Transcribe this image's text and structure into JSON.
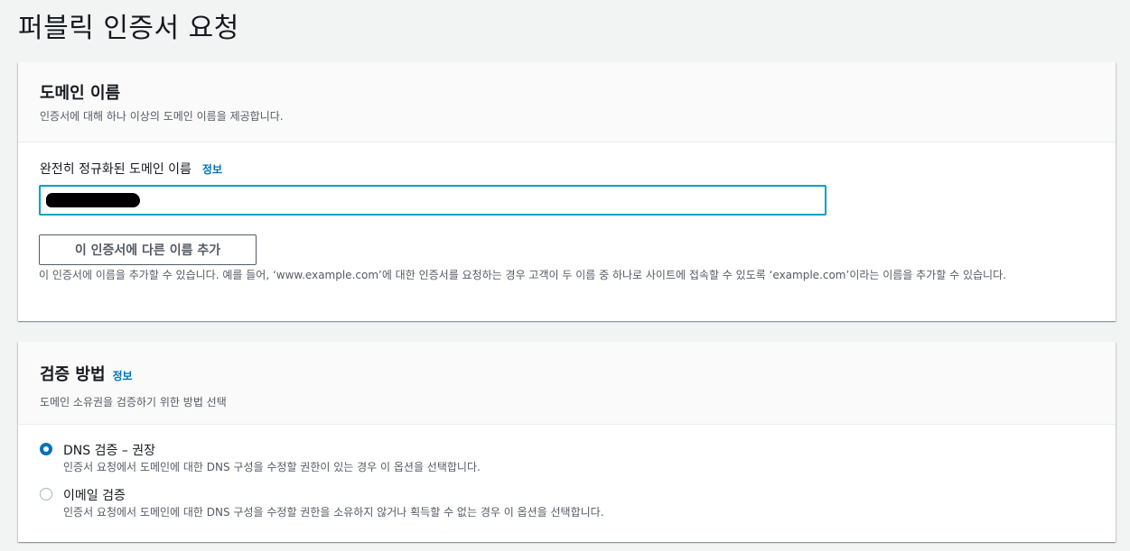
{
  "page": {
    "title": "퍼블릭 인증서 요청"
  },
  "domain_panel": {
    "title": "도메인 이름",
    "description": "인증서에 대해 하나 이상의 도메인 이름을 제공합니다.",
    "field_label": "완전히 정규화된 도메인 이름",
    "info_link": "정보",
    "domain_value": "",
    "add_button": "이 인증서에 다른 이름 추가",
    "help_text": "이 인증서에 이름을 추가할 수 있습니다. 예를 들어, ‘www.example.com’에 대한 인증서를 요청하는 경우 고객이 두 이름 중 하나로 사이트에 접속할 수 있도록 ‘example.com’이라는 이름을 추가할 수 있습니다."
  },
  "validation_panel": {
    "title": "검증 방법",
    "info_link": "정보",
    "description": "도메인 소유권을 검증하기 위한 방법 선택",
    "options": [
      {
        "label": "DNS 검증 – 권장",
        "description": "인증서 요청에서 도메인에 대한 DNS 구성을 수정할 권한이 있는 경우 이 옵션을 선택합니다.",
        "selected": true
      },
      {
        "label": "이메일 검증",
        "description": "인증서 요청에서 도메인에 대한 DNS 구성을 수정할 권한을 소유하지 않거나 획득할 수 없는 경우 이 옵션을 선택합니다.",
        "selected": false
      }
    ]
  },
  "colors": {
    "accent": "#0073bb",
    "input_focus": "#00a1c9",
    "background": "#f2f3f3"
  }
}
